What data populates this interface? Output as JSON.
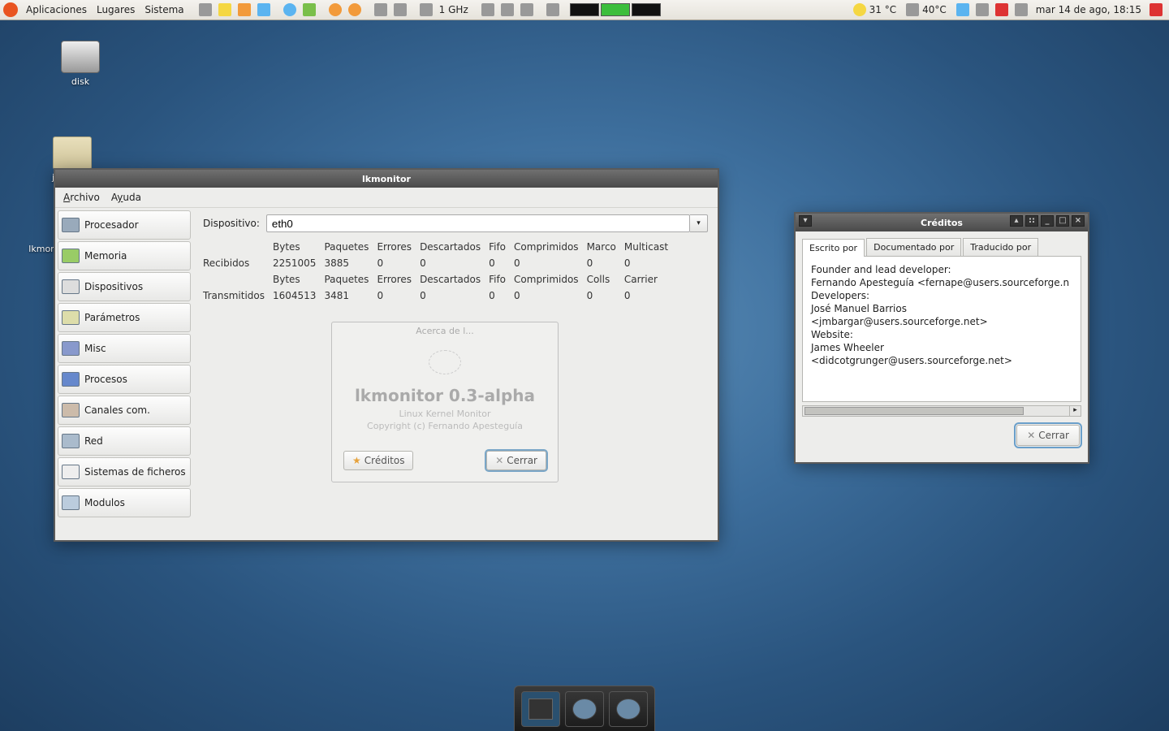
{
  "panel": {
    "menus": [
      "Aplicaciones",
      "Lugares",
      "Sistema"
    ],
    "cpu_label": "1 GHz",
    "temp1": "31 °C",
    "temp2": "40°C",
    "clock": "mar 14 de ago, 18:15"
  },
  "desktop": {
    "icons": [
      {
        "label": "disk"
      },
      {
        "label": "jmbargar website"
      },
      {
        "label": "lkmoni..."
      }
    ]
  },
  "lk": {
    "title": "lkmonitor",
    "menus": [
      "Archivo",
      "Ayuda"
    ],
    "sidebar": [
      "Procesador",
      "Memoria",
      "Dispositivos",
      "Parámetros",
      "Misc",
      "Procesos",
      "Canales com.",
      "Red",
      "Sistemas de ficheros",
      "Modulos"
    ],
    "device_label": "Dispositivo:",
    "device_value": "eth0",
    "cols1": [
      "Bytes",
      "Paquetes",
      "Errores",
      "Descartados",
      "Fifo",
      "Comprimidos",
      "Marco",
      "Multicast"
    ],
    "row_recv_label": "Recibidos",
    "row_recv": [
      "2251005",
      "3885",
      "0",
      "0",
      "0",
      "0",
      "0",
      "0"
    ],
    "cols2": [
      "Bytes",
      "Paquetes",
      "Errores",
      "Descartados",
      "Fifo",
      "Comprimidos",
      "Colls",
      "Carrier"
    ],
    "row_tx_label": "Transmitidos",
    "row_tx": [
      "1604513",
      "3481",
      "0",
      "0",
      "0",
      "0",
      "0",
      "0"
    ]
  },
  "about": {
    "title_bar": "Acerca de l...",
    "title": "lkmonitor 0.3-alpha",
    "sub1": "Linux Kernel Monitor",
    "sub2": "Copyright (c) Fernando Apesteguía",
    "credits_btn": "Créditos",
    "close_btn": "Cerrar"
  },
  "credits": {
    "title": "Créditos",
    "tabs": [
      "Escrito por",
      "Documentado por",
      "Traducido por"
    ],
    "lines": [
      "Founder and lead developer:",
      "Fernando Apesteguía <fernape@users.sourceforge.n",
      "Developers:",
      "José Manuel Barrios",
      "<jmbargar@users.sourceforge.net>",
      "Website:",
      "James Wheeler",
      "<didcotgrunger@users.sourceforge.net>"
    ],
    "close_btn": "Cerrar"
  }
}
